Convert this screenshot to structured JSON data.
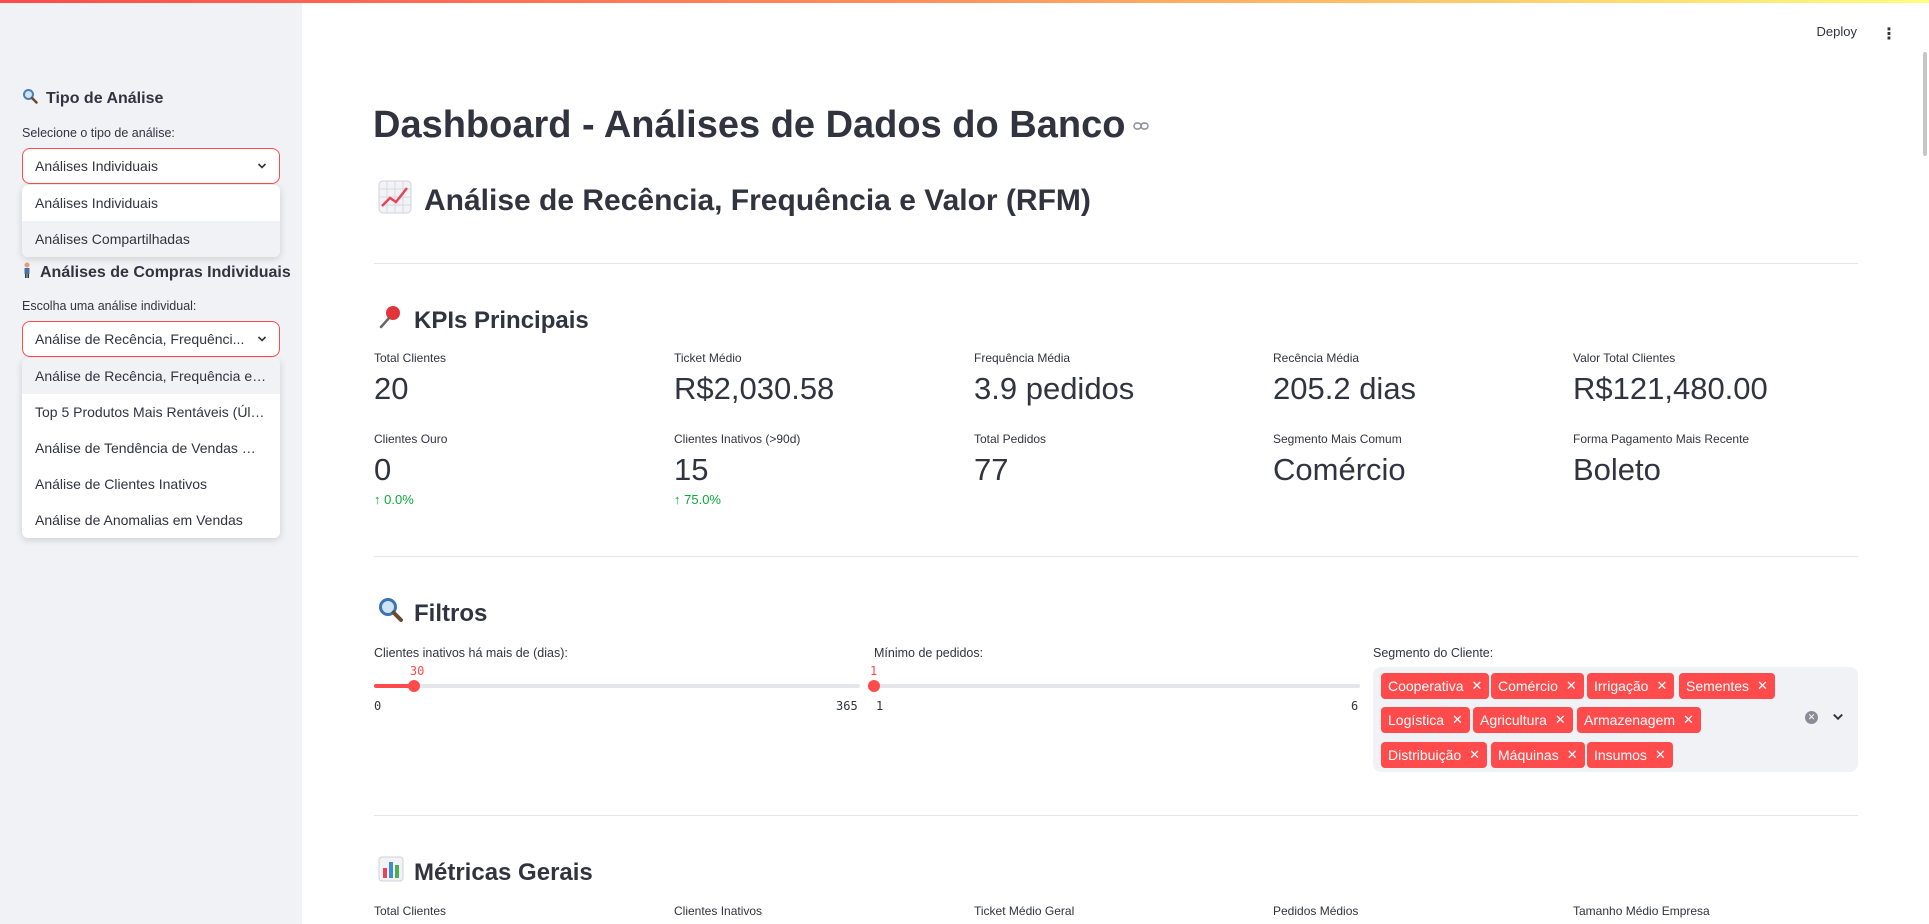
{
  "sidebar": {
    "analysis_type_heading": "Tipo de Análise",
    "analysis_type_label": "Selecione o tipo de análise:",
    "analysis_type_selected": "Análises Individuais",
    "analysis_type_options": [
      "Análises Individuais",
      "Análises Compartilhadas"
    ],
    "individual_heading": "Análises de Compras Individuais",
    "individual_label": "Escolha uma análise individual:",
    "individual_selected": "Análise de Recência, Frequênci...",
    "individual_options": [
      "Análise de Recência, Frequência e V...",
      "Top 5 Produtos Mais Rentáveis (Últi...",
      "Análise de Tendência de Vendas Me...",
      "Análise de Clientes Inativos",
      "Análise de Anomalias em Vendas"
    ]
  },
  "header": {
    "deploy": "Deploy",
    "menu": "⋮"
  },
  "main": {
    "title": "Dashboard - Análises de Dados do Banco",
    "rfm_heading": "Análise de Recência, Frequência e Valor (RFM)",
    "kpi_heading": "KPIs Principais",
    "kpis_row1": [
      {
        "label": "Total Clientes",
        "value": "20"
      },
      {
        "label": "Ticket Médio",
        "value": "R$2,030.58"
      },
      {
        "label": "Frequência Média",
        "value": "3.9 pedidos"
      },
      {
        "label": "Recência Média",
        "value": "205.2 dias"
      },
      {
        "label": "Valor Total Clientes",
        "value": "R$121,480.00"
      }
    ],
    "kpis_row2": [
      {
        "label": "Clientes Ouro",
        "value": "0",
        "delta": "0.0%"
      },
      {
        "label": "Clientes Inativos (>90d)",
        "value": "15",
        "delta": "75.0%"
      },
      {
        "label": "Total Pedidos",
        "value": "77"
      },
      {
        "label": "Segmento Mais Comum",
        "value": "Comércio"
      },
      {
        "label": "Forma Pagamento Mais Recente",
        "value": "Boleto"
      }
    ],
    "filters_heading": "Filtros",
    "slider_inactive": {
      "label": "Clientes inativos há mais de (dias):",
      "value": "30",
      "min": "0",
      "max": "365",
      "fraction": 0.082
    },
    "slider_orders": {
      "label": "Mínimo de pedidos:",
      "value": "1",
      "min": "1",
      "max": "6",
      "fraction": 0.0
    },
    "segment": {
      "label": "Segmento do Cliente:",
      "tags": [
        "Cooperativa",
        "Comércio",
        "Irrigação",
        "Sementes",
        "Logística",
        "Agricultura",
        "Armazenagem",
        "Distribuição",
        "Máquinas",
        "Insumos"
      ]
    },
    "metrics_heading": "Métricas Gerais",
    "metrics_labels": [
      "Total Clientes",
      "Clientes Inativos",
      "Ticket Médio Geral",
      "Pedidos Médios",
      "Tamanho Médio Empresa"
    ]
  },
  "colors": {
    "accent": "#ff4b4b",
    "positive": "#09ab3b",
    "sidebar_bg": "#f0f2f6"
  }
}
